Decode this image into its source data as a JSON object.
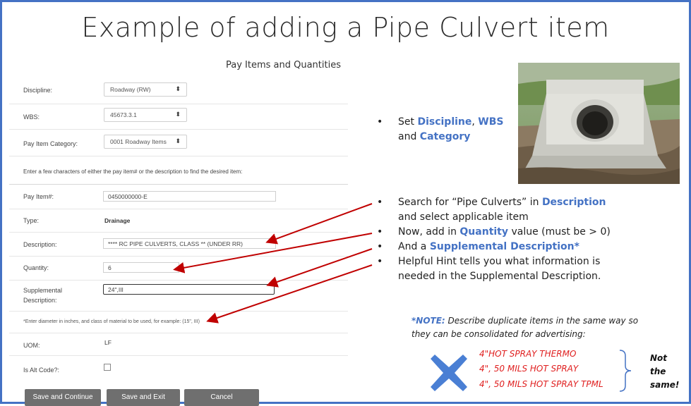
{
  "slide": {
    "title": "Example of adding a Pipe Culvert item"
  },
  "form": {
    "title": "Pay Items and Quantities",
    "discipline": {
      "label": "Discipline:",
      "value": "Roadway (RW)"
    },
    "wbs": {
      "label": "WBS:",
      "value": "45673.3.1"
    },
    "category": {
      "label": "Pay Item Category:",
      "value": "0001 Roadway Items"
    },
    "search_instructions": "Enter a few characters of either the pay item# or the description to find the desired item:",
    "pay_item": {
      "label": "Pay Item#:",
      "value": "0450000000-E"
    },
    "type": {
      "label": "Type:",
      "value": "Drainage"
    },
    "description": {
      "label": "Description:",
      "value": "**** RC PIPE CULVERTS, CLASS  ** (UNDER RR)"
    },
    "quantity": {
      "label": "Quantity:",
      "value": "6"
    },
    "supplemental": {
      "label_line1": "Supplemental",
      "label_line2": "Description:",
      "value": "24\",III"
    },
    "hint": "*Enter diameter in inches, and class of material to be used, for example: (15\", III)",
    "uom": {
      "label": "UOM:",
      "value": "LF"
    },
    "alt_code": {
      "label": "Is Alt Code?:",
      "checked": false
    },
    "buttons": {
      "save_continue": "Save and Continue",
      "save_exit": "Save and Exit",
      "cancel": "Cancel"
    }
  },
  "bullets": {
    "b1": {
      "dot": "•",
      "t1": "Set ",
      "h1": "Discipline",
      "t2": ", ",
      "h2": "WBS",
      "t3": "and ",
      "h3": "Category"
    },
    "b2": {
      "dot": "•",
      "t1": "Search for “Pipe Culverts” in ",
      "h1": "Description",
      "t2": "and select applicable item"
    },
    "b3": {
      "dot": "•",
      "t1": "Now, add in ",
      "h1": "Quantity",
      "t2": " value (must be > 0)"
    },
    "b4": {
      "dot": "•",
      "t1": "And a ",
      "h1": "Supplemental Description*"
    },
    "b5": {
      "dot": "•",
      "t1": "Helpful Hint tells you what information is",
      "t2": "needed in the Supplemental Description."
    }
  },
  "note": {
    "key": "*NOTE:",
    "text1": " Describe duplicate items in the same way so",
    "text2": "they can be consolidated for advertising:",
    "examples": [
      "4\"HOT SPRAY THERMO",
      "4\", 50 MILS HOT SPRAY",
      "4\", 50 MILS HOT SPRAY TPML"
    ],
    "not_same": [
      "Not",
      "the",
      "same!"
    ]
  },
  "colors": {
    "accent": "#4472c4",
    "arrow": "#c00000",
    "x_mark": "#4a7fd4",
    "red_text": "#e02020",
    "button": "#6f6f6f"
  },
  "icons": {
    "dropdown": "updown-arrow-icon",
    "reject": "x-mark-icon",
    "photo": "culvert-photo"
  }
}
